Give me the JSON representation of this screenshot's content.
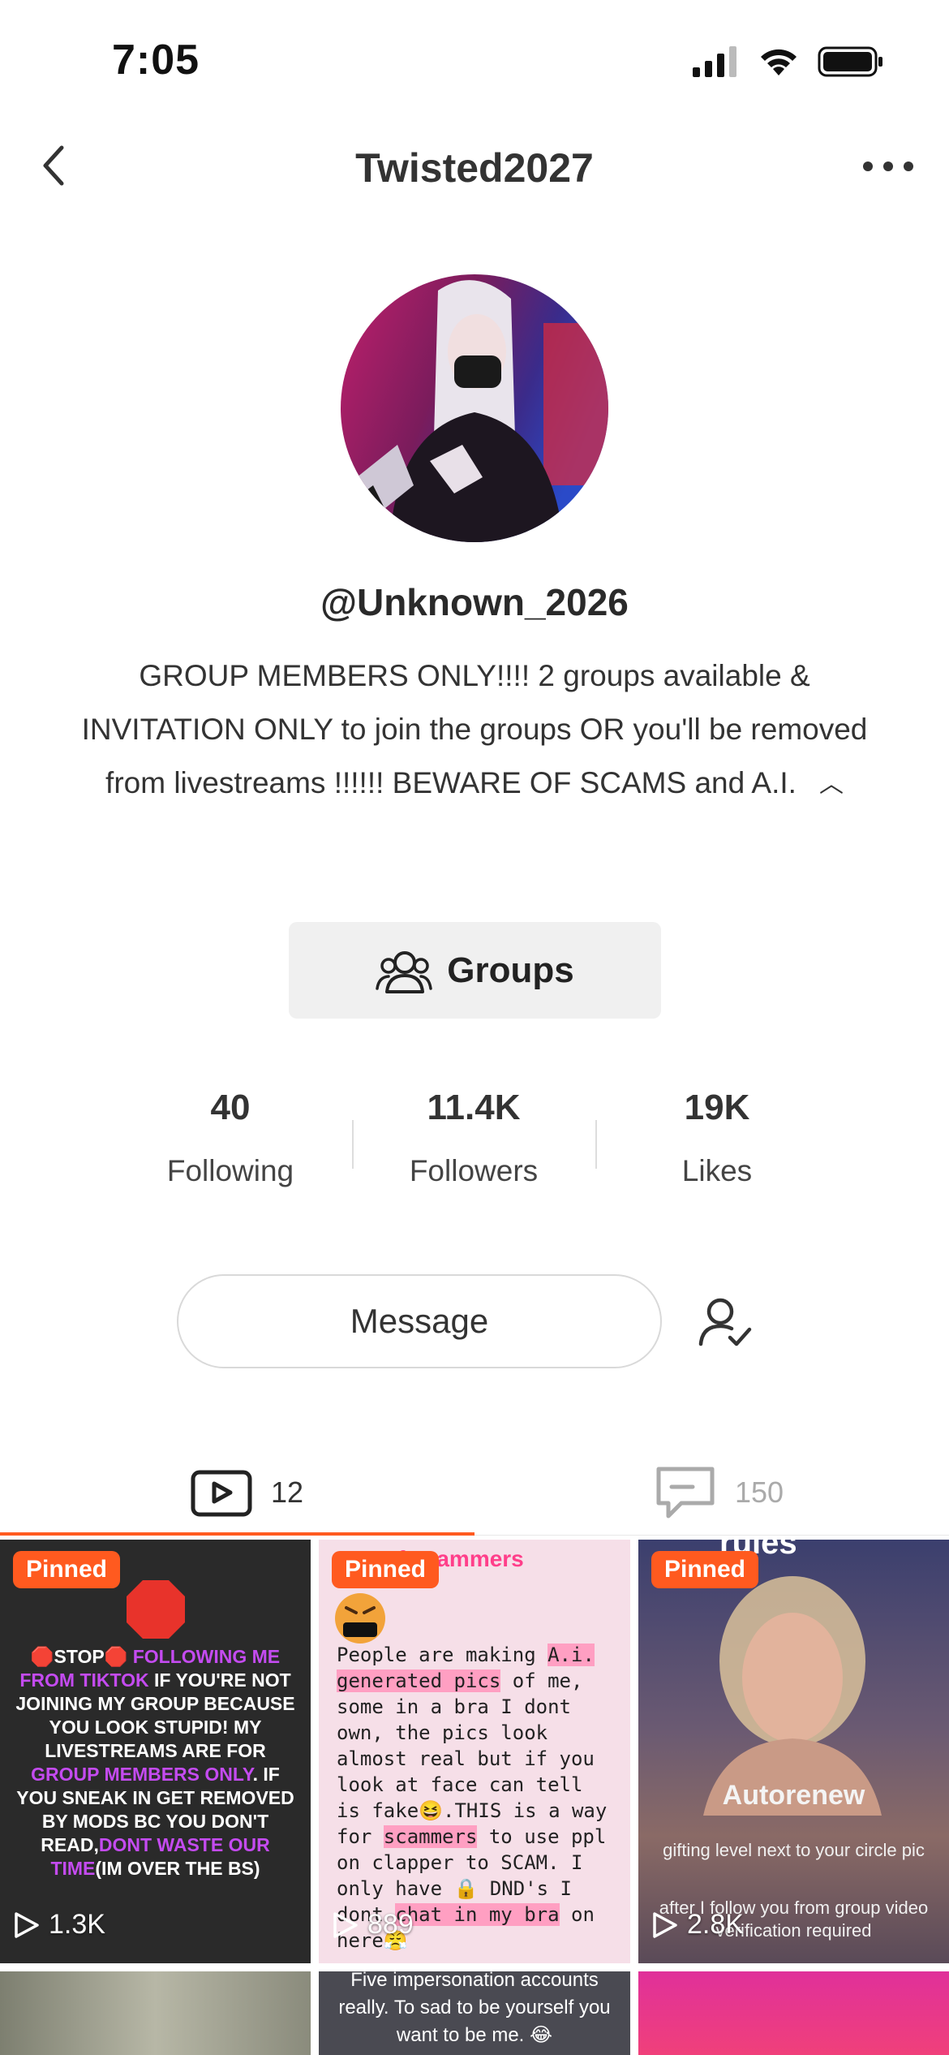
{
  "status": {
    "time": "7:05"
  },
  "nav": {
    "title": "Twisted2027"
  },
  "profile": {
    "handle": "@Unknown_2026",
    "bio": "GROUP MEMBERS ONLY!!!!  2 groups available & INVITATION ONLY to join the groups OR you'll be removed from livestreams !!!!!! BEWARE OF SCAMS and A.I."
  },
  "groups_button": {
    "label": "Groups"
  },
  "stats": [
    {
      "value": "40",
      "label": "Following"
    },
    {
      "value": "11.4K",
      "label": "Followers"
    },
    {
      "value": "19K",
      "label": "Likes"
    }
  ],
  "message_button": {
    "label": "Message"
  },
  "tabs": [
    {
      "icon": "video-icon",
      "count": "12"
    },
    {
      "icon": "comment-icon",
      "count": "150"
    }
  ],
  "grid": {
    "pinned_label": "Pinned",
    "tiles": [
      {
        "views": "1.3K",
        "text_parts": [
          "🛑STOP🛑 ",
          "FOLLOWING ME FROM TIKTOK",
          " IF YOU'RE NOT JOINING MY GROUP BECAUSE YOU LOOK STUPID! MY LIVESTREAMS ARE FOR ",
          "GROUP MEMBERS ONLY",
          ". IF YOU SNEAK IN GET REMOVED BY MODS BC YOU DON'T READ,",
          "DONT WASTE OUR TIME",
          "(IM OVER THE BS)"
        ]
      },
      {
        "views": "889",
        "header": "of scammers",
        "text_parts": [
          "People are making ",
          "A.i. generated pics",
          " of me, some in a bra I dont own, the pics look almost real but if you look at face can tell is fake😆.THIS is a way for ",
          "scammers",
          " to use ppl on clapper to SCAM. I only have 🔒 DND's I dont ",
          "chat in my bra",
          " on here😤"
        ]
      },
      {
        "views": "2.8K",
        "top": "rules",
        "title": "Autorenew",
        "line1": "gifting level next to your circle pic",
        "line2": "after I follow you from group video verification required"
      },
      {
        "text": ""
      },
      {
        "text": "Five impersonation accounts really. To sad to be yourself you want to be me. 😂"
      },
      {
        "text": ""
      }
    ]
  },
  "colors": {
    "accent": "#ff5a1f",
    "highlight_pink": "#ff9fc2",
    "purple_text": "#c44bf0"
  }
}
